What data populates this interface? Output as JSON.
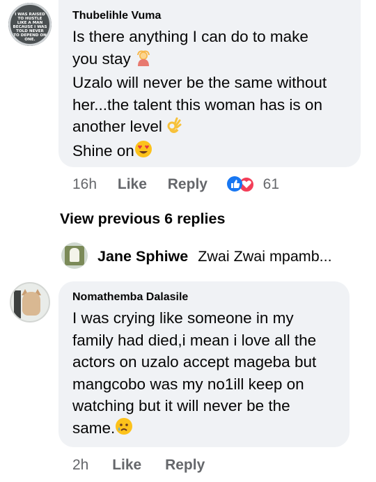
{
  "comment1": {
    "avatar_text": "I WAS RAISED TO HUSTLE LIKE A MAN BECAUSE I WAS TOLD NEVER TO DEPEND ON ONE.",
    "author": "Thubelihle Vuma",
    "lines": [
      "Is there anything I can do to make",
      "you stay",
      "Uzalo will never be the same without",
      "her...the talent this woman has is on",
      "another level",
      "Shine on"
    ],
    "time": "16h",
    "like_label": "Like",
    "reply_label": "Reply",
    "reaction_count": "61"
  },
  "replies_link": "View previous 6 replies",
  "reply_preview": {
    "author": "Jane Sphiwe",
    "text": "Zwai Zwai mpamb..."
  },
  "comment2": {
    "author": "Nomathemba Dalasile",
    "lines": [
      "I was crying like someone in my",
      "family had died,i mean i love all the",
      "actors on uzalo accept mageba but",
      "mangcobo was my no1ill keep on",
      "watching but it will never be the",
      "same."
    ],
    "time": "2h",
    "like_label": "Like",
    "reply_label": "Reply"
  }
}
